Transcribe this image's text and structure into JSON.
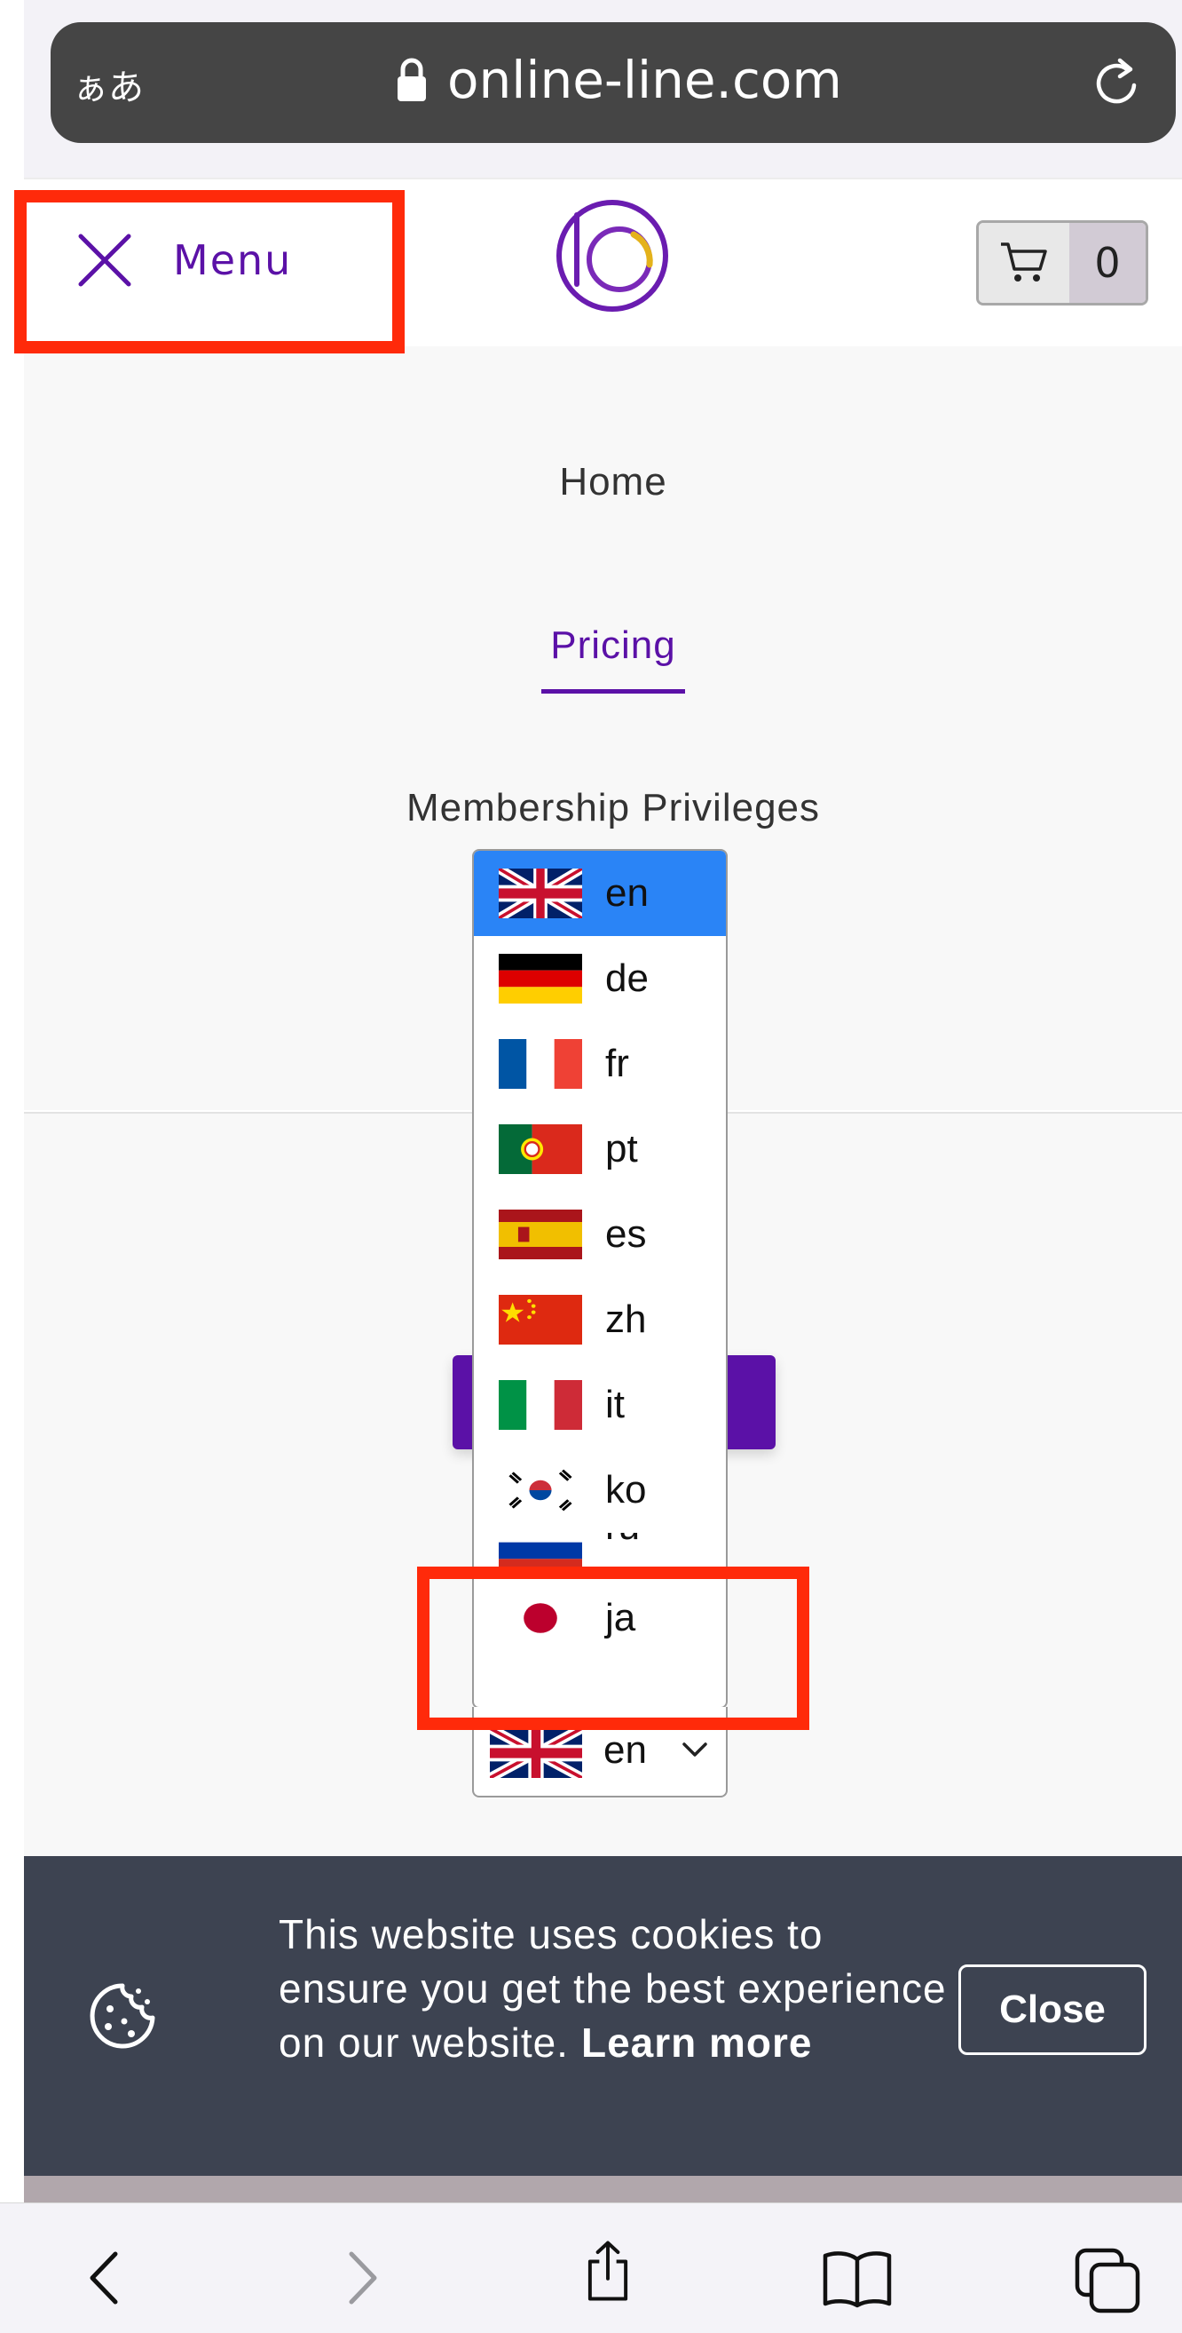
{
  "browser": {
    "aa_label": "ぁあ",
    "url": "online-line.com"
  },
  "header": {
    "menu_label": "Menu",
    "cart_count": "0"
  },
  "nav": {
    "items": [
      {
        "label": "Home"
      },
      {
        "label": "Pricing",
        "active": true
      },
      {
        "label": "Membership Privileges"
      }
    ]
  },
  "language_dropdown": {
    "options": [
      {
        "code": "en",
        "selected": true
      },
      {
        "code": "de"
      },
      {
        "code": "fr"
      },
      {
        "code": "pt"
      },
      {
        "code": "es"
      },
      {
        "code": "zh"
      },
      {
        "code": "it"
      },
      {
        "code": "ko"
      },
      {
        "code": "ru"
      },
      {
        "code": "ja"
      }
    ],
    "current_value": "en"
  },
  "cookie_banner": {
    "message": "This website uses cookies to ensure you get the best experience on our website.",
    "learn_more": "Learn more",
    "close_label": "Close"
  },
  "colors": {
    "accent": "#5b11a7",
    "highlight": "#ff2a0a",
    "selected_option": "#2a84f6",
    "cookie_bg": "#3d4351"
  },
  "icons": [
    "lock-icon",
    "reload-icon",
    "close-x-icon",
    "logo-icon",
    "cart-icon",
    "cookie-icon",
    "back-icon",
    "forward-icon",
    "share-icon",
    "bookmarks-icon",
    "tabs-icon"
  ]
}
